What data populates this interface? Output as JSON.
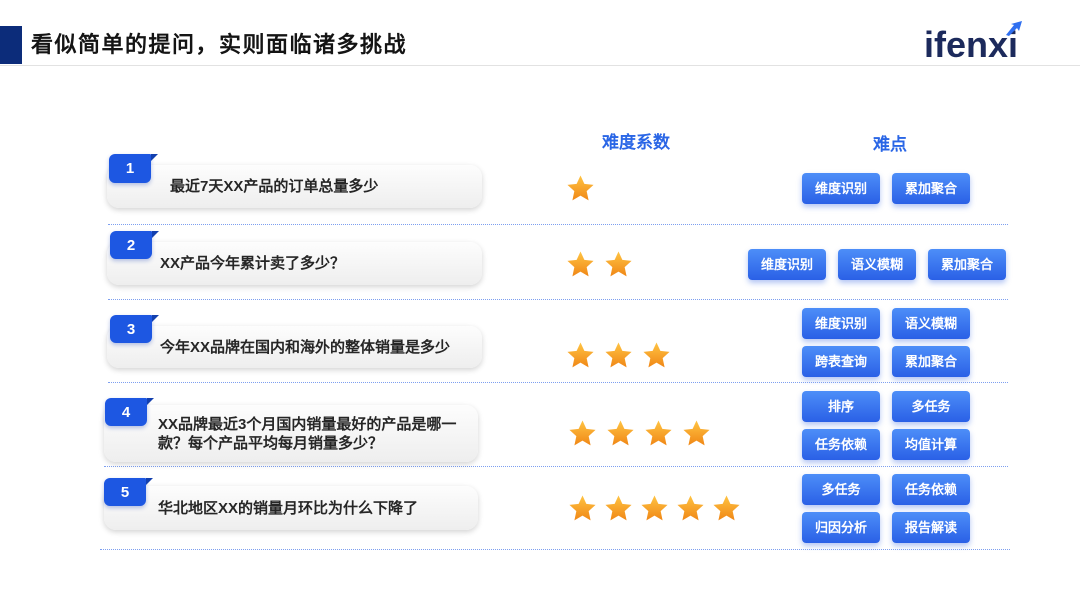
{
  "header": {
    "title": "看似简单的提问，实则面临诸多挑战",
    "logo": "ifenxi"
  },
  "columns": {
    "difficulty": "难度系数",
    "challenges": "难点"
  },
  "rows": [
    {
      "num": "1",
      "question": "最近7天XX产品的订单总量多少",
      "stars": 1,
      "tags": [
        "维度识别",
        "累加聚合"
      ]
    },
    {
      "num": "2",
      "question": "XX产品今年累计卖了多少？",
      "stars": 2,
      "tags": [
        "维度识别",
        "语义模糊",
        "累加聚合"
      ]
    },
    {
      "num": "3",
      "question": "今年XX品牌在国内和海外的整体销量是多少",
      "stars": 3,
      "tags": [
        "维度识别",
        "语义模糊",
        "跨表查询",
        "累加聚合"
      ]
    },
    {
      "num": "4",
      "question": "XX品牌最近3个月国内销量最好的产品是哪一款？每个产品平均每月销量多少？",
      "stars": 4,
      "tags": [
        "排序",
        "多任务",
        "任务依赖",
        "均值计算"
      ]
    },
    {
      "num": "5",
      "question": "华北地区XX的销量月环比为什么下降了",
      "stars": 5,
      "tags": [
        "多任务",
        "任务依赖",
        "归因分析",
        "报告解读"
      ]
    }
  ],
  "icons": {
    "rating": "star-icon",
    "logo_mark": "arrow-icon"
  },
  "colors": {
    "title_bar": "#0c2c7a",
    "title_text": "#141414",
    "column_header": "#2a66e6",
    "badge": "#1d57e2",
    "badge_fold": "#123fae",
    "tag_top": "#4d8ef8",
    "tag_bottom": "#2a60e6",
    "star_top": "#ffc443",
    "star_bottom": "#f08716",
    "divider": "#7d9ff0",
    "logo_text": "#1c2a5c",
    "logo_accent": "#2f6ff0"
  }
}
